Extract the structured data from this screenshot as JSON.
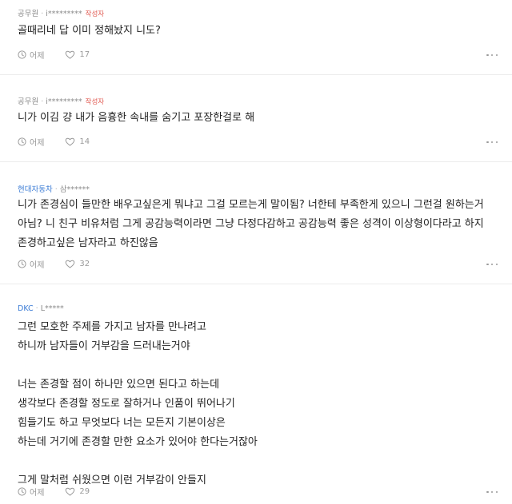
{
  "comments": [
    {
      "company": "공무원",
      "separator": "·",
      "author": "i*********",
      "author_tag": "작성자",
      "text": "골때리네 답 이미 정해놨지 니도?",
      "time": "어제",
      "likes": "17"
    },
    {
      "company": "공무원",
      "separator": "·",
      "author": "i*********",
      "author_tag": "작성자",
      "text": "니가 이김 걍 내가 음흉한 속내를 숨기고 포장한걸로 해",
      "time": "어제",
      "likes": "14"
    },
    {
      "company": "현대자동차",
      "separator": "·",
      "author": "삼******",
      "author_tag": "",
      "text": "니가 존경심이 들만한 배우고싶은게 뭐냐고 그걸 모르는게 말이됨? 너한테 부족한게 있으니 그런걸 원하는거\n아님? 니 친구 비유처럼 그게 공감능력이라면 그냥 다정다감하고 공감능력 좋은 성격이 이상형이다라고 하지\n존경하고싶은 남자라고 하진않음",
      "time": "어제",
      "likes": "32"
    },
    {
      "company": "DKC",
      "separator": "·",
      "author": "L*****",
      "author_tag": "",
      "text": "그런 모호한 주제를 가지고 남자를 만나려고\n하니까 남자들이 거부감을 드러내는거야\n\n너는 존경할 점이 하나만 있으면 된다고 하는데\n생각보다 존경할 정도로 잘하거나 인품이 뛰어나기\n힘들기도 하고 무엇보다 너는 모든지 기본이상은\n하는데 거기에 존경할 만한 요소가 있어야 한다는거잖아\n\n그게 말처럼 쉬웠으면 이런 거부감이 안들지",
      "time": "어제",
      "likes": "29"
    }
  ],
  "colors": {
    "company_link": "#3a7bd5",
    "author_tag": "#e0584f",
    "muted": "#8a8a8a",
    "divider": "#ececec"
  },
  "icons": [
    "clock-icon",
    "heart-icon",
    "more-icon"
  ]
}
